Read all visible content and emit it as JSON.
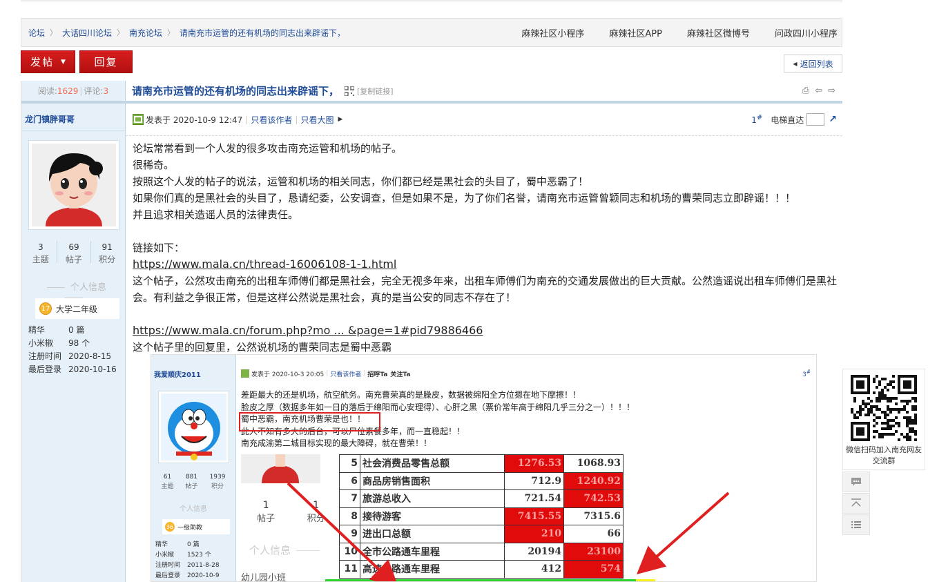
{
  "breadcrumb": {
    "items": [
      "论坛",
      "大话四川论坛",
      "南充论坛",
      "请南充市运管的还有机场的同志出来辟谣下，"
    ]
  },
  "top_links": [
    "麻辣社区小程序",
    "麻辣社区APP",
    "麻辣社区微博号",
    "问政四川小程序"
  ],
  "buttons": {
    "post": "发帖",
    "reply": "回复",
    "back_to_list": "返回列表"
  },
  "thread": {
    "views_label": "阅读:",
    "views": "1629",
    "comments_label": "评论:",
    "comments": "3",
    "title": "请南充市运管的还有机场的同志出来辟谣下，",
    "copy_link": "[复制链接]"
  },
  "author": {
    "name": "龙门镇胖哥哥",
    "stats": [
      {
        "value": "3",
        "label": "主题"
      },
      {
        "value": "69",
        "label": "帖子"
      },
      {
        "value": "91",
        "label": "积分"
      }
    ],
    "info_heading": "个人信息",
    "level_num": "17",
    "level": "大学二年级",
    "profile": [
      {
        "k": "精华",
        "v": "0 篇"
      },
      {
        "k": "小米椒",
        "v": "98 个"
      },
      {
        "k": "注册时间",
        "v": "2020-8-15"
      },
      {
        "k": "最后登录",
        "v": "2020-10-16"
      }
    ]
  },
  "post_meta": {
    "posted_at": "发表于 2020-10-9 12:47",
    "only_author": "只看该作者",
    "only_images": "只看大图",
    "floor": "1",
    "floor_mark": "#",
    "elevator": "电梯直达"
  },
  "content": {
    "paragraphs": [
      "论坛常常看到一个人发的很多攻击南充运管和机场的帖子。",
      "很稀奇。",
      "按照这个人发的帖子的说法，运管和机场的相关同志，你们都已经是黑社会的头目了，蜀中恶霸了！",
      "如果你们真的是黑社会的头目了，恳请纪委，公安调查，但是如果不是，为了你们名誉，请南充市运管曾颖同志和机场的曹荣同志立即辟谣！！！并且追求相关造谣人员的法律责任。",
      "",
      "链接如下："
    ],
    "link1": "https://www.mala.cn/thread-16006108-1-1.html",
    "para_after_link1": "这个帖子，公然攻击南充的出租车师傅们都是黑社会，完全无视多年来，出租车师傅们为南充的交通发展做出的巨大贡献。公然造谣说出租车师傅们是黑社会。有利益之争很正常，但是这样公然说是黑社会，真的是当公安的同志不存在了！",
    "link2": "https://www.mala.cn/forum.php?mo ... &page=1#pid79886466",
    "para_after_link2": "这个帖子里的回复里，公然说机场的曹荣同志是蜀中恶霸"
  },
  "embedded_screenshot": {
    "author": "我爱顺庆2011",
    "stats": [
      {
        "value": "61",
        "label": "主题"
      },
      {
        "value": "881",
        "label": "帖子"
      },
      {
        "value": "1939",
        "label": "积分"
      }
    ],
    "info_heading": "个人信息",
    "level_num": "36",
    "level": "一级助教",
    "profile": [
      {
        "k": "精华",
        "v": "0 篇"
      },
      {
        "k": "小米椒",
        "v": "1523 个"
      },
      {
        "k": "注册时间",
        "v": "2011-8-28"
      },
      {
        "k": "最后登录",
        "v": "2020-10-9"
      }
    ],
    "posted_at": "发表于 2020-10-3 20:05",
    "only_author": "只看该作者",
    "greet": "招呼Ta",
    "follow": "关注Ta",
    "floor": "3",
    "floor_mark": "#",
    "lines": [
      "差距最大的还是机场，航空航务。南充曹荣真的是臊皮，数据被绵阳全方位摁在地下摩擦！！",
      "脸皮之厚（数据多年如一日的落后于绵阳而心安理得）、心肝之黑（票价常年高于绵阳几乎三分之一）！！！",
      "蜀中恶霸，南充机场曹荣是也！！",
      "此人不知有多大的后台，可以尸位素餐多年，而一直稳起！！",
      "南充成渝第二城目标实现的最大障碍，就在曹荣！！"
    ],
    "inner_stats": [
      {
        "value": "1",
        "label": "帖子"
      },
      {
        "value": "1",
        "label": "积分"
      }
    ],
    "inner_info": "个人信息",
    "inner_level": "幼儿园小班",
    "table_rows": [
      {
        "no": "5",
        "name": "社会消费品零售总额",
        "a": "1276.53",
        "b": "1068.93",
        "red": "a"
      },
      {
        "no": "6",
        "name": "商品房销售面积",
        "a": "712.9",
        "b": "1240.92",
        "red": "b"
      },
      {
        "no": "7",
        "name": "旅游总收入",
        "a": "721.54",
        "b": "742.53",
        "red": "b"
      },
      {
        "no": "8",
        "name": "接待游客",
        "a": "7415.55",
        "b": "7315.6",
        "red": "a"
      },
      {
        "no": "9",
        "name": "进出口总额",
        "a": "210",
        "b": "66",
        "red": "a"
      },
      {
        "no": "10",
        "name": "全市公路通车里程",
        "a": "20194",
        "b": "23100",
        "red": "b"
      },
      {
        "no": "11",
        "name": "高速公路通车里程",
        "a": "412",
        "b": "574",
        "red": "b"
      }
    ]
  },
  "qr_panel": {
    "caption": "微信扫码加入南充网友交流群"
  },
  "colors": {
    "brand_red": "#c81515",
    "link_blue": "#1f4c99",
    "sidebar_bg": "#e6f0f8"
  }
}
